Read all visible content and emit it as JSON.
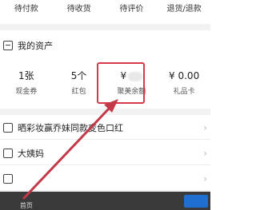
{
  "orders": [
    "待付款",
    "待收货",
    "待评价",
    "退货/退款"
  ],
  "assets": {
    "title": "我的资产",
    "items": [
      {
        "value": "1张",
        "label": "现金券"
      },
      {
        "value": "5个",
        "label": "红包"
      },
      {
        "value": "¥",
        "label": "聚美余额"
      },
      {
        "value": "¥ 0.00",
        "label": "礼品卡"
      }
    ]
  },
  "list": [
    {
      "label": "晒彩妆赢乔妹同款变色口红"
    },
    {
      "label": "大姨妈"
    },
    {
      "label": ""
    }
  ],
  "nav": [
    "首页",
    "",
    "",
    ""
  ],
  "colors": {
    "highlight": "#d6394a",
    "arrow": "#c2394a"
  }
}
